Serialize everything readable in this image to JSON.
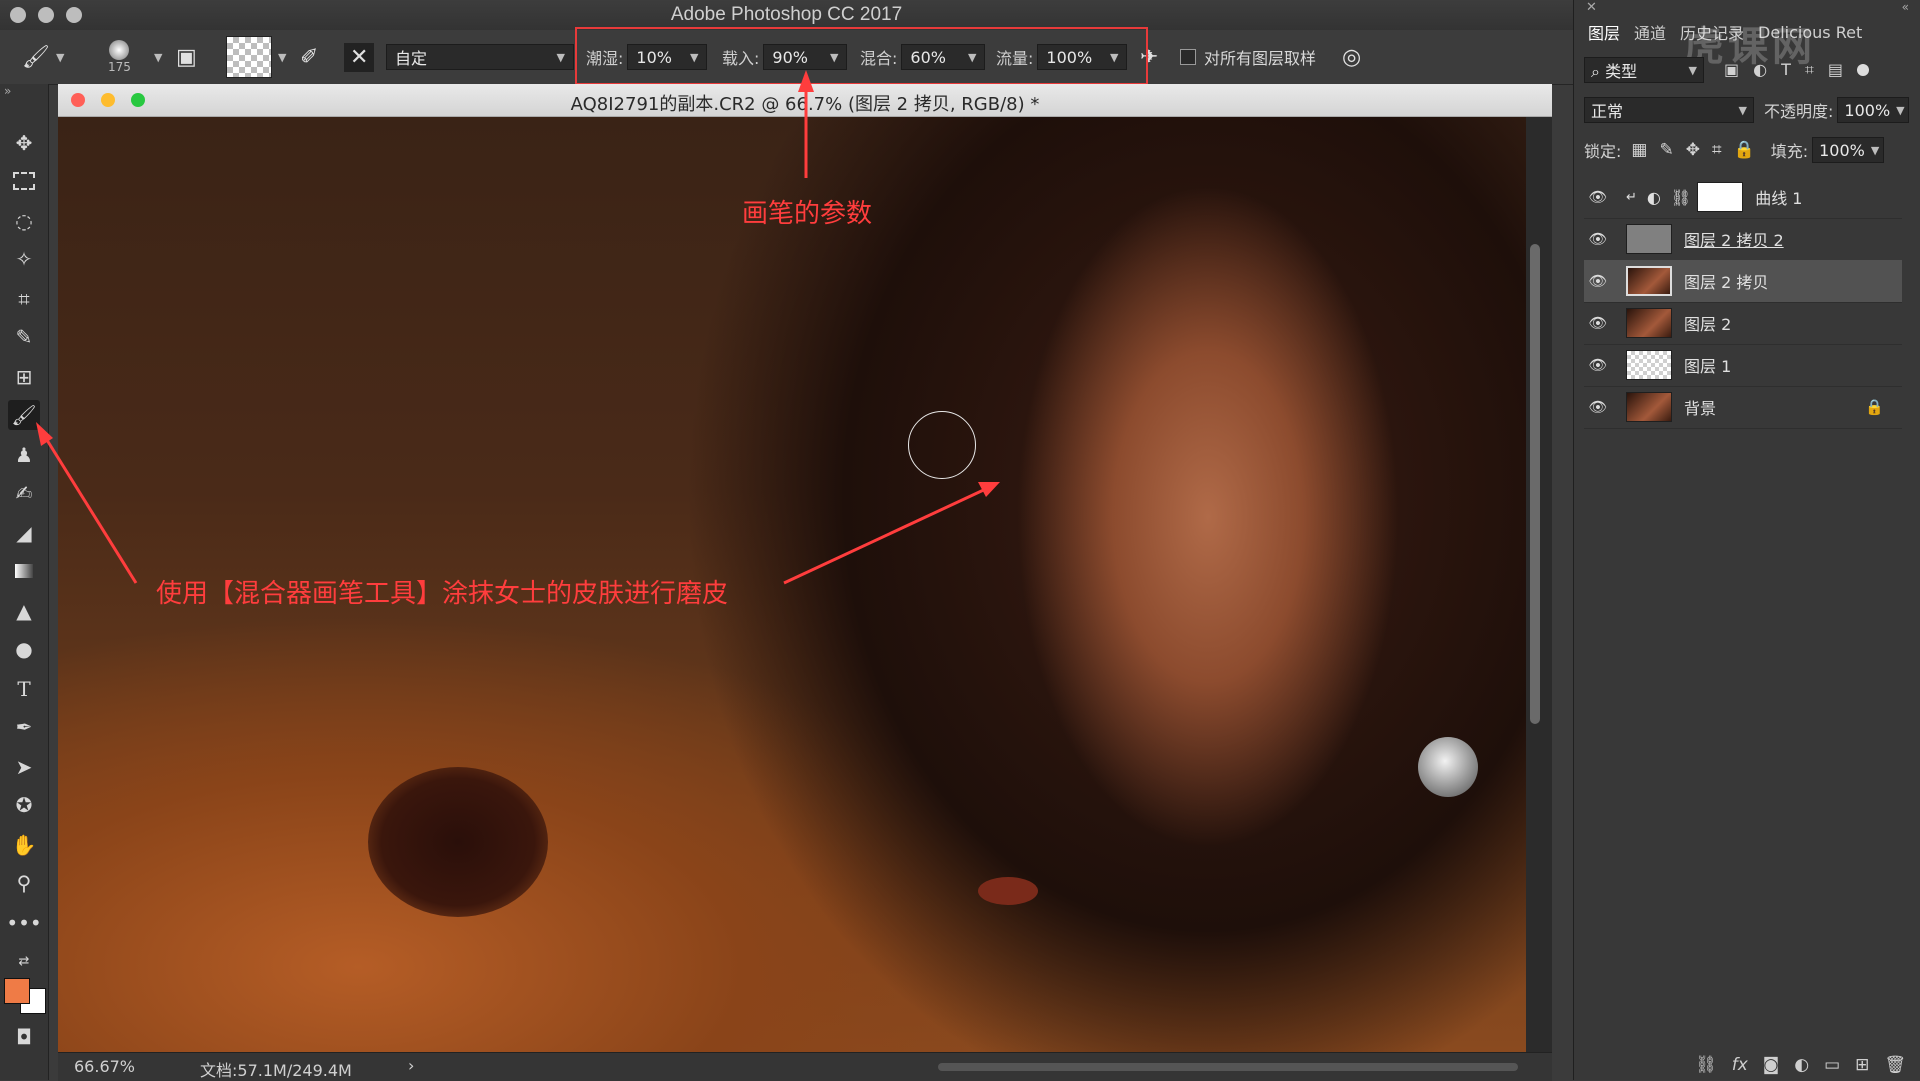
{
  "window": {
    "app_title": "Adobe Photoshop CC 2017"
  },
  "options": {
    "brush_size": "175",
    "preset": "自定",
    "params": [
      {
        "label": "潮湿:",
        "value": "10%"
      },
      {
        "label": "载入:",
        "value": "90%"
      },
      {
        "label": "混合:",
        "value": "60%"
      },
      {
        "label": "流量:",
        "value": "100%"
      }
    ],
    "sample_all_label": "对所有图层取样"
  },
  "document": {
    "title": "AQ8I2791的副本.CR2 @ 66.7% (图层 2 拷贝, RGB/8) *",
    "zoom": "66.67%",
    "doc_size": "文档:57.1M/249.4M"
  },
  "annotations": {
    "brush_params": "画笔的参数",
    "tool_usage": "使用【混合器画笔工具】涂抹女士的皮肤进行磨皮"
  },
  "colors": {
    "foreground": "#ef7b46",
    "background": "#ffffff",
    "annotation": "#ff3d3d"
  },
  "panel": {
    "tabs": [
      "图层",
      "通道",
      "历史记录",
      "Delicious Ret"
    ],
    "filter_kind": "类型",
    "blend_mode": "正常",
    "opacity_label": "不透明度:",
    "opacity": "100%",
    "lock_label": "锁定:",
    "fill_label": "填充:",
    "fill": "100%",
    "layers": [
      {
        "name": "曲线 1",
        "selected": false
      },
      {
        "name": "图层 2 拷贝 2",
        "selected": false
      },
      {
        "name": "图层 2 拷贝",
        "selected": true
      },
      {
        "name": "图层 2",
        "selected": false
      },
      {
        "name": "图层 1",
        "selected": false
      },
      {
        "name": "背景",
        "selected": false
      }
    ]
  },
  "watermark": "虎课网"
}
